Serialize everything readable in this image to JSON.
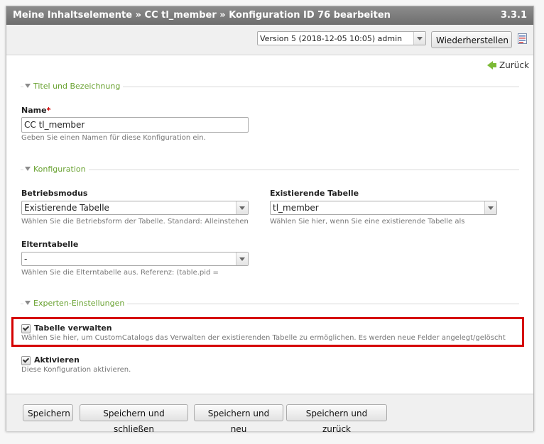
{
  "header": {
    "breadcrumb": "Meine Inhaltselemente » CC tl_member » Konfiguration ID 76 bearbeiten",
    "version": "3.3.1"
  },
  "version_bar": {
    "selected_version": "Version 5 (2018-12-05 10:05) admin",
    "restore_label": "Wiederherstellen",
    "diff_icon": "diff-icon"
  },
  "back_label": "Zurück",
  "sections": {
    "title": "Titel und Bezeichnung",
    "config": "Konfiguration",
    "expert": "Experten-Einstellungen"
  },
  "fields": {
    "name": {
      "label": "Name",
      "required": "*",
      "value": "CC tl_member",
      "help": "Geben Sie einen Namen für diese Konfiguration ein."
    },
    "mode": {
      "label": "Betriebsmodus",
      "value": "Existierende Tabelle",
      "help": "Wählen Sie die Betriebsform der Tabelle. Standard: Alleinstehen"
    },
    "table": {
      "label": "Existierende Tabelle",
      "value": "tl_member",
      "help": "Wählen Sie hier, wenn Sie eine existierende Tabelle als"
    },
    "parent": {
      "label": "Elterntabelle",
      "value": "-",
      "help": "Wählen Sie die Elterntabelle aus. Referenz: (table.pid ="
    },
    "manage": {
      "label": "Tabelle verwalten",
      "checked": true,
      "help": "Wählen Sie hier, um CustomCatalogs das Verwalten der existierenden Tabelle zu ermöglichen. Es werden neue Felder angelegt/gelöscht"
    },
    "active": {
      "label": "Aktivieren",
      "checked": true,
      "help": "Diese Konfiguration aktivieren."
    }
  },
  "footer": {
    "save": "Speichern",
    "save_close": "Speichern und schließen",
    "save_new": "Speichern und neu",
    "save_back": "Speichern und zurück"
  },
  "colors": {
    "accent_green": "#69a231",
    "highlight_red": "#d50000",
    "titlebar": "#7a7a7a"
  }
}
